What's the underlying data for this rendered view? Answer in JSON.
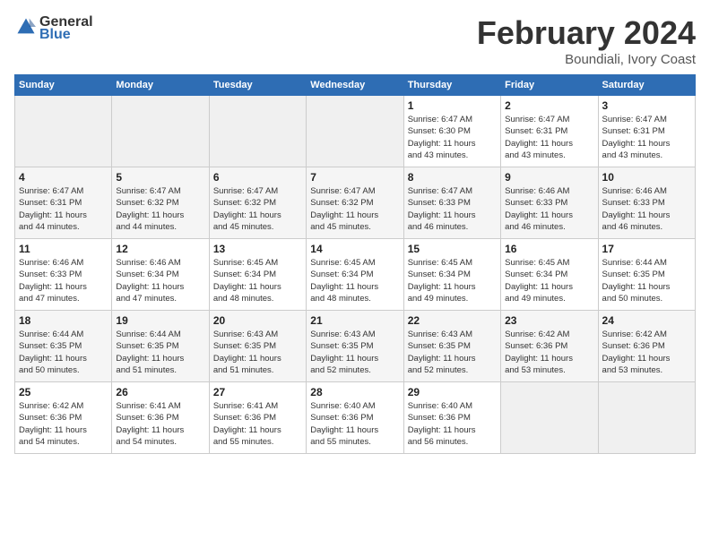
{
  "header": {
    "logo_line1": "General",
    "logo_line2": "Blue",
    "month": "February 2024",
    "location": "Boundiali, Ivory Coast"
  },
  "days_of_week": [
    "Sunday",
    "Monday",
    "Tuesday",
    "Wednesday",
    "Thursday",
    "Friday",
    "Saturday"
  ],
  "weeks": [
    [
      {
        "day": "",
        "info": ""
      },
      {
        "day": "",
        "info": ""
      },
      {
        "day": "",
        "info": ""
      },
      {
        "day": "",
        "info": ""
      },
      {
        "day": "1",
        "info": "Sunrise: 6:47 AM\nSunset: 6:30 PM\nDaylight: 11 hours\nand 43 minutes."
      },
      {
        "day": "2",
        "info": "Sunrise: 6:47 AM\nSunset: 6:31 PM\nDaylight: 11 hours\nand 43 minutes."
      },
      {
        "day": "3",
        "info": "Sunrise: 6:47 AM\nSunset: 6:31 PM\nDaylight: 11 hours\nand 43 minutes."
      }
    ],
    [
      {
        "day": "4",
        "info": "Sunrise: 6:47 AM\nSunset: 6:31 PM\nDaylight: 11 hours\nand 44 minutes."
      },
      {
        "day": "5",
        "info": "Sunrise: 6:47 AM\nSunset: 6:32 PM\nDaylight: 11 hours\nand 44 minutes."
      },
      {
        "day": "6",
        "info": "Sunrise: 6:47 AM\nSunset: 6:32 PM\nDaylight: 11 hours\nand 45 minutes."
      },
      {
        "day": "7",
        "info": "Sunrise: 6:47 AM\nSunset: 6:32 PM\nDaylight: 11 hours\nand 45 minutes."
      },
      {
        "day": "8",
        "info": "Sunrise: 6:47 AM\nSunset: 6:33 PM\nDaylight: 11 hours\nand 46 minutes."
      },
      {
        "day": "9",
        "info": "Sunrise: 6:46 AM\nSunset: 6:33 PM\nDaylight: 11 hours\nand 46 minutes."
      },
      {
        "day": "10",
        "info": "Sunrise: 6:46 AM\nSunset: 6:33 PM\nDaylight: 11 hours\nand 46 minutes."
      }
    ],
    [
      {
        "day": "11",
        "info": "Sunrise: 6:46 AM\nSunset: 6:33 PM\nDaylight: 11 hours\nand 47 minutes."
      },
      {
        "day": "12",
        "info": "Sunrise: 6:46 AM\nSunset: 6:34 PM\nDaylight: 11 hours\nand 47 minutes."
      },
      {
        "day": "13",
        "info": "Sunrise: 6:45 AM\nSunset: 6:34 PM\nDaylight: 11 hours\nand 48 minutes."
      },
      {
        "day": "14",
        "info": "Sunrise: 6:45 AM\nSunset: 6:34 PM\nDaylight: 11 hours\nand 48 minutes."
      },
      {
        "day": "15",
        "info": "Sunrise: 6:45 AM\nSunset: 6:34 PM\nDaylight: 11 hours\nand 49 minutes."
      },
      {
        "day": "16",
        "info": "Sunrise: 6:45 AM\nSunset: 6:34 PM\nDaylight: 11 hours\nand 49 minutes."
      },
      {
        "day": "17",
        "info": "Sunrise: 6:44 AM\nSunset: 6:35 PM\nDaylight: 11 hours\nand 50 minutes."
      }
    ],
    [
      {
        "day": "18",
        "info": "Sunrise: 6:44 AM\nSunset: 6:35 PM\nDaylight: 11 hours\nand 50 minutes."
      },
      {
        "day": "19",
        "info": "Sunrise: 6:44 AM\nSunset: 6:35 PM\nDaylight: 11 hours\nand 51 minutes."
      },
      {
        "day": "20",
        "info": "Sunrise: 6:43 AM\nSunset: 6:35 PM\nDaylight: 11 hours\nand 51 minutes."
      },
      {
        "day": "21",
        "info": "Sunrise: 6:43 AM\nSunset: 6:35 PM\nDaylight: 11 hours\nand 52 minutes."
      },
      {
        "day": "22",
        "info": "Sunrise: 6:43 AM\nSunset: 6:35 PM\nDaylight: 11 hours\nand 52 minutes."
      },
      {
        "day": "23",
        "info": "Sunrise: 6:42 AM\nSunset: 6:36 PM\nDaylight: 11 hours\nand 53 minutes."
      },
      {
        "day": "24",
        "info": "Sunrise: 6:42 AM\nSunset: 6:36 PM\nDaylight: 11 hours\nand 53 minutes."
      }
    ],
    [
      {
        "day": "25",
        "info": "Sunrise: 6:42 AM\nSunset: 6:36 PM\nDaylight: 11 hours\nand 54 minutes."
      },
      {
        "day": "26",
        "info": "Sunrise: 6:41 AM\nSunset: 6:36 PM\nDaylight: 11 hours\nand 54 minutes."
      },
      {
        "day": "27",
        "info": "Sunrise: 6:41 AM\nSunset: 6:36 PM\nDaylight: 11 hours\nand 55 minutes."
      },
      {
        "day": "28",
        "info": "Sunrise: 6:40 AM\nSunset: 6:36 PM\nDaylight: 11 hours\nand 55 minutes."
      },
      {
        "day": "29",
        "info": "Sunrise: 6:40 AM\nSunset: 6:36 PM\nDaylight: 11 hours\nand 56 minutes."
      },
      {
        "day": "",
        "info": ""
      },
      {
        "day": "",
        "info": ""
      }
    ]
  ]
}
